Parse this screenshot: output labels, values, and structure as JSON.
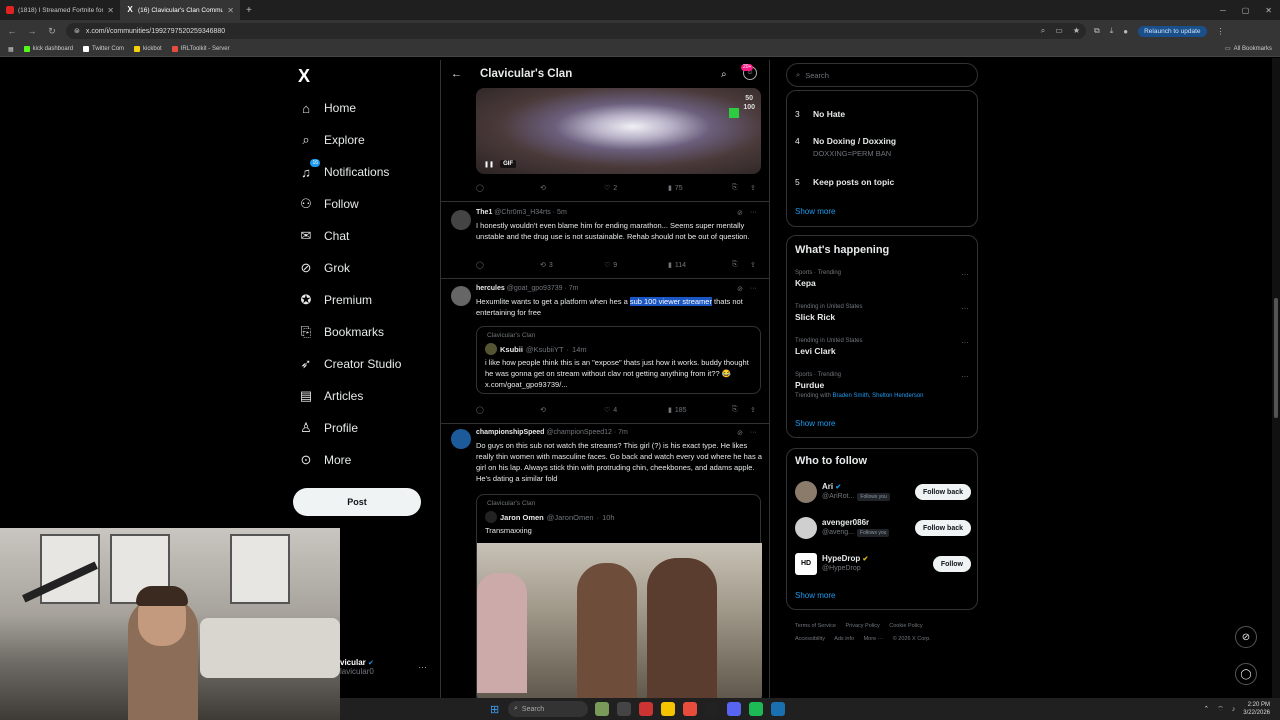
{
  "browser": {
    "tabs": [
      {
        "title": "(1818) I Streamed Fortnite for"
      },
      {
        "title": "(16) Clavicular's Clan Communi"
      }
    ],
    "url": "x.com/i/communities/1992797520259346880",
    "relaunch_label": "Relaunch to update",
    "bookmarks": [
      "kick dashboard",
      "Twitter Com",
      "kickbot",
      "IRLToolkit - Server"
    ],
    "all_bookmarks_label": "All Bookmarks"
  },
  "sidebar": {
    "logo": "X",
    "notifications_badge": "16",
    "items": [
      {
        "label": "Home",
        "icon": "home-icon"
      },
      {
        "label": "Explore",
        "icon": "search-icon"
      },
      {
        "label": "Notifications",
        "icon": "bell-icon"
      },
      {
        "label": "Follow",
        "icon": "follow-icon"
      },
      {
        "label": "Chat",
        "icon": "mail-icon"
      },
      {
        "label": "Grok",
        "icon": "grok-icon"
      },
      {
        "label": "Premium",
        "icon": "premium-icon"
      },
      {
        "label": "Bookmarks",
        "icon": "bookmark-icon"
      },
      {
        "label": "Creator Studio",
        "icon": "rocket-icon"
      },
      {
        "label": "Articles",
        "icon": "articles-icon"
      },
      {
        "label": "Profile",
        "icon": "person-icon"
      },
      {
        "label": "More",
        "icon": "more-icon"
      }
    ],
    "post_label": "Post",
    "user": {
      "name": "vicular",
      "handle": "lavicular0"
    }
  },
  "community": {
    "title": "Clavicular's Clan",
    "badge": "20+"
  },
  "feed": {
    "gif_post": {
      "gif_label": "GIF",
      "overlay_text": [
        "50",
        "100"
      ],
      "stats": {
        "replies": "",
        "reposts": "",
        "likes": "2",
        "views": "75"
      }
    },
    "posts": [
      {
        "name": "The1",
        "handle": "@Chr0m3_H34rts",
        "time": "5m",
        "text": "I honestly wouldn't even blame him for ending marathon... Seems super mentally unstable and the drug use is not sustainable. Rehab should not be out of question.",
        "stats": {
          "replies": "",
          "reposts": "3",
          "likes": "9",
          "views": "114"
        }
      },
      {
        "name": "hercules",
        "handle": "@goat_gpo93739",
        "time": "7m",
        "text_before": "Hexumlite wants to get a platform when hes a ",
        "text_highlight": "sub 100 viewer streamer",
        "text_after": " thats not entertaining for free",
        "quote": {
          "community": "Clavicular's Clan",
          "name": "Ksubii",
          "handle": "@KsubiiYT",
          "time": "14m",
          "text": "i like how people think this is an \"expose\" thats just how it works. buddy thought he was gonna get on stream without clav not getting anything from it?? 😂 x.com/goat_gpo93739/..."
        },
        "stats": {
          "replies": "",
          "reposts": "",
          "likes": "4",
          "views": "185"
        }
      },
      {
        "name": "championshipSpeed",
        "handle": "@championSpeed12",
        "time": "7m",
        "text": "Do guys on this sub not watch the streams? This girl (?) is his exact type. He likes really thin women with masculine faces. Go back and watch every vod where he has a girl on his lap. Always stick thin with protruding chin, cheekbones, and adams apple. He's dating a similar fold",
        "quote": {
          "community": "Clavicular's Clan",
          "name": "Jaron Omen",
          "handle": "@JaronOmen",
          "time": "10h",
          "text": "Transmaxxing"
        }
      }
    ]
  },
  "right": {
    "search_placeholder": "Search",
    "rules": [
      {
        "num": "3",
        "title": "No Hate",
        "sub": ""
      },
      {
        "num": "4",
        "title": "No Doxing / Doxxing",
        "sub": "DOXXING=PERM BAN"
      },
      {
        "num": "5",
        "title": "Keep posts on topic",
        "sub": ""
      }
    ],
    "show_more": "Show more",
    "happening_title": "What's happening",
    "trends": [
      {
        "meta": "Sports · Trending",
        "name": "Kepa",
        "with": ""
      },
      {
        "meta": "Trending in United States",
        "name": "Slick Rick",
        "with": ""
      },
      {
        "meta": "Trending in United States",
        "name": "Levi Clark",
        "with": ""
      },
      {
        "meta": "Sports · Trending",
        "name": "Purdue",
        "with_prefix": "Trending with",
        "with": "Braden Smith, Shelton Henderson"
      }
    ],
    "wtf_title": "Who to follow",
    "follows": [
      {
        "name": "Ari",
        "handle": "@AriRot...",
        "follows_you": "Follows you",
        "button": "Follow back"
      },
      {
        "name": "avenger086r",
        "handle": "@aveng...",
        "follows_you": "Follows you",
        "button": "Follow back"
      },
      {
        "name": "HypeDrop",
        "handle": "@HypeDrop",
        "follows_you": "",
        "button": "Follow",
        "avatar_text": "HD"
      }
    ],
    "footer": [
      "Terms of Service",
      "Privacy Policy",
      "Cookie Policy",
      "Accessibility",
      "Ads info",
      "More ···",
      "© 2026 X Corp."
    ]
  },
  "taskbar": {
    "search_label": "Search",
    "time": "2:20 PM",
    "date": "3/22/2026"
  },
  "colors": {
    "accent": "#1d9bf0",
    "highlight": "#1a56c4",
    "background": "#000000",
    "border": "#2f3336"
  }
}
